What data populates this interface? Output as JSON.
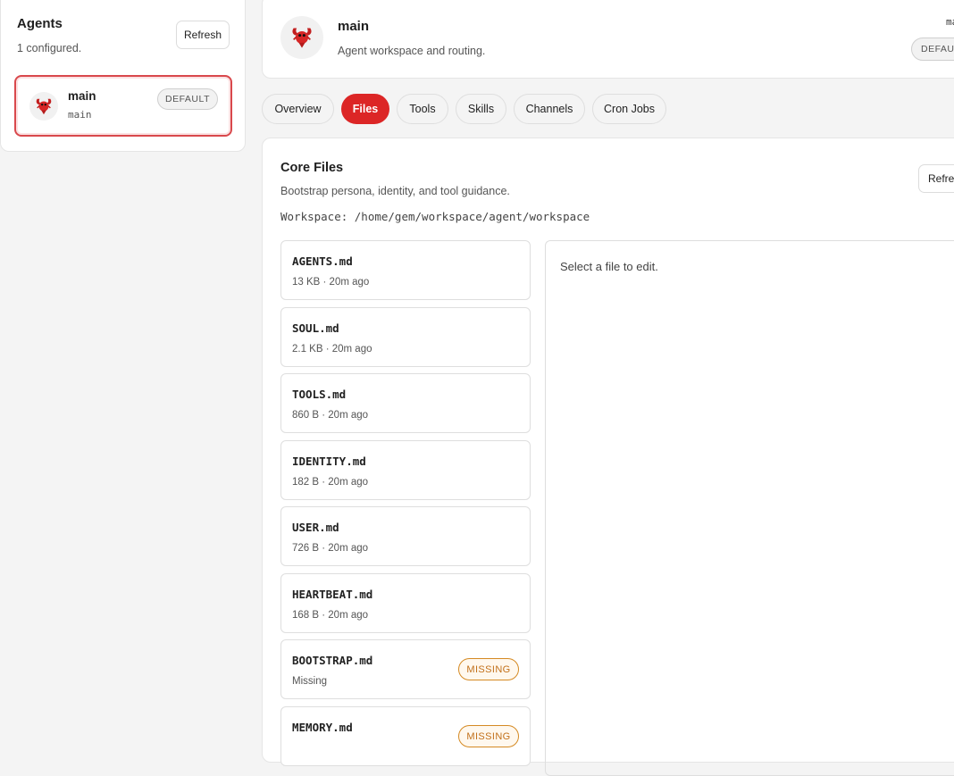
{
  "colors": {
    "accent": "#dc2626",
    "missing": "#d58a23"
  },
  "sidebar": {
    "title": "Agents",
    "subtitle": "1 configured.",
    "refresh_label": "Refresh",
    "agents": [
      {
        "name": "main",
        "id": "main",
        "badge": "DEFAULT",
        "icon": "lobster-icon"
      }
    ]
  },
  "header": {
    "title": "main",
    "subtitle": "Agent workspace and routing.",
    "corner_text": "ma",
    "badge": "DEFAUL",
    "icon": "lobster-icon"
  },
  "tabs": [
    {
      "label": "Overview",
      "active": false
    },
    {
      "label": "Files",
      "active": true
    },
    {
      "label": "Tools",
      "active": false
    },
    {
      "label": "Skills",
      "active": false
    },
    {
      "label": "Channels",
      "active": false
    },
    {
      "label": "Cron Jobs",
      "active": false
    }
  ],
  "core_files": {
    "title": "Core Files",
    "subtitle": "Bootstrap persona, identity, and tool guidance.",
    "workspace": "Workspace: /home/gem/workspace/agent/workspace",
    "refresh_label": "Refres",
    "editor_placeholder": "Select a file to edit.",
    "files": [
      {
        "name": "AGENTS.md",
        "meta": "13 KB · 20m ago"
      },
      {
        "name": "SOUL.md",
        "meta": "2.1 KB · 20m ago"
      },
      {
        "name": "TOOLS.md",
        "meta": "860 B · 20m ago"
      },
      {
        "name": "IDENTITY.md",
        "meta": "182 B · 20m ago"
      },
      {
        "name": "USER.md",
        "meta": "726 B · 20m ago"
      },
      {
        "name": "HEARTBEAT.md",
        "meta": "168 B · 20m ago"
      },
      {
        "name": "BOOTSTRAP.md",
        "meta": "Missing",
        "badge": "MISSING"
      },
      {
        "name": "MEMORY.md",
        "meta": "",
        "badge": "MISSING"
      }
    ]
  }
}
